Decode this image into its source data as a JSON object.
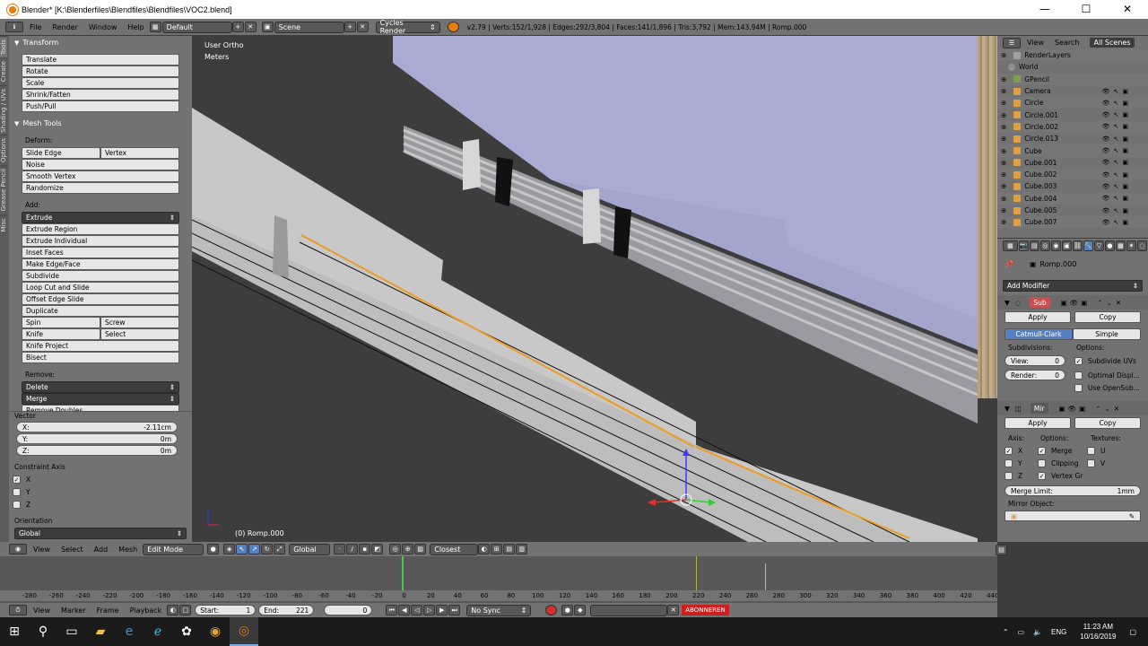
{
  "window": {
    "title": "Blender* [K:\\Blenderfiles\\Blendfiles\\Blendfiles\\VOC2.blend]",
    "min": "—",
    "max": "☐",
    "close": "✕"
  },
  "infobar": {
    "menus": [
      "File",
      "Render",
      "Window",
      "Help"
    ],
    "layout": "Default",
    "scene": "Scene",
    "engine": "Cycles Render",
    "stats": "v2.79 | Verts:152/1,928 | Edges:292/3,804 | Faces:141/1,896 | Tris:3,792 | Mem:143.94M | Romp.000"
  },
  "vtabs": [
    "Tools",
    "Create",
    "Shading / UVs",
    "Options",
    "Grease Pencil",
    "Misc"
  ],
  "toolshelf": {
    "transform_title": "Transform",
    "transform": [
      "Translate",
      "Rotate",
      "Scale",
      "Shrink/Fatten",
      "Push/Pull"
    ],
    "meshtools_title": "Mesh Tools",
    "deform_label": "Deform:",
    "slide_edge": "Slide Edge",
    "vertex": "Vertex",
    "deform_rest": [
      "Noise",
      "Smooth Vertex",
      "Randomize"
    ],
    "add_label": "Add:",
    "extrude": "Extrude",
    "add_items": [
      "Extrude Region",
      "Extrude Individual",
      "Inset Faces",
      "Make Edge/Face",
      "Subdivide",
      "Loop Cut and Slide",
      "Offset Edge Slide",
      "Duplicate"
    ],
    "spin": "Spin",
    "screw": "Screw",
    "knife": "Knife",
    "select": "Select",
    "knife_project": "Knife Project",
    "bisect": "Bisect",
    "remove_label": "Remove:",
    "delete": "Delete",
    "merge": "Merge",
    "remove_doubles": "Remove Doubles"
  },
  "operator": {
    "vector_label": "Vector",
    "x_label": "X:",
    "x_value": "-2.11cm",
    "y_label": "Y:",
    "y_value": "0m",
    "z_label": "Z:",
    "z_value": "0m",
    "constraint_label": "Constraint Axis",
    "axes": [
      {
        "name": "X",
        "checked": "✓"
      },
      {
        "name": "Y",
        "checked": ""
      },
      {
        "name": "Z",
        "checked": ""
      }
    ],
    "orientation_label": "Orientation",
    "orientation": "Global"
  },
  "viewport": {
    "view_name": "User Ortho",
    "units": "Meters",
    "object_label": "(0) Romp.000"
  },
  "vpheader": {
    "menus": [
      "View",
      "Select",
      "Add",
      "Mesh"
    ],
    "mode": "Edit Mode",
    "orientation": "Global",
    "snap": "Closest"
  },
  "timeline": {
    "ticks": [
      "-280",
      "-260",
      "-240",
      "-220",
      "-200",
      "-180",
      "-160",
      "-140",
      "-120",
      "-100",
      "-80",
      "-60",
      "-40",
      "-20",
      "0",
      "20",
      "40",
      "60",
      "80",
      "100",
      "120",
      "140",
      "160",
      "180",
      "200",
      "220",
      "240",
      "260",
      "280",
      "300",
      "320",
      "340",
      "360",
      "380",
      "400",
      "420",
      "440"
    ]
  },
  "tlheader": {
    "menus": [
      "View",
      "Marker",
      "Frame",
      "Playback"
    ],
    "start_label": "Start:",
    "start": "1",
    "end_label": "End:",
    "end": "221",
    "current": "0",
    "sync": "No Sync"
  },
  "outliner": {
    "menus": [
      "View",
      "Search"
    ],
    "filter": "All Scenes",
    "items": [
      "RenderLayers",
      "World",
      "GPencil",
      "Camera",
      "Circle",
      "Circle.001",
      "Circle.002",
      "Circle.013",
      "Cube",
      "Cube.001",
      "Cube.002",
      "Cube.003",
      "Cube.004",
      "Cube.005",
      "Cube.007"
    ]
  },
  "props": {
    "object": "Romp.000",
    "add_modifier": "Add Modifier",
    "mod1_name": "Sub",
    "apply": "Apply",
    "copy": "Copy",
    "catmull": "Catmull-Clark",
    "simple": "Simple",
    "subdivisions": "Subdivisions:",
    "options": "Options:",
    "view_label": "View:",
    "view_value": "0",
    "render_label": "Render:",
    "render_value": "0",
    "subdivide_uvs": "Subdivide UVs",
    "optimal": "Optimal Displ...",
    "opensubdiv": "Use OpenSub...",
    "mod2_name": "Mir",
    "axis": "Axis:",
    "options2": "Options:",
    "textures": "Textures:",
    "x": "X",
    "y": "Y",
    "z": "Z",
    "merge": "Merge",
    "clipping": "Clipping",
    "vertexgr": "Vertex Gr",
    "u": "U",
    "v": "V",
    "merge_limit_label": "Merge Limit:",
    "merge_limit": "1mm",
    "mirror_object": "Mirror Object:"
  },
  "taskbar": {
    "lang": "ENG",
    "time": "11:23 AM",
    "date": "10/16/2019",
    "notice": "ABONNEREN"
  }
}
